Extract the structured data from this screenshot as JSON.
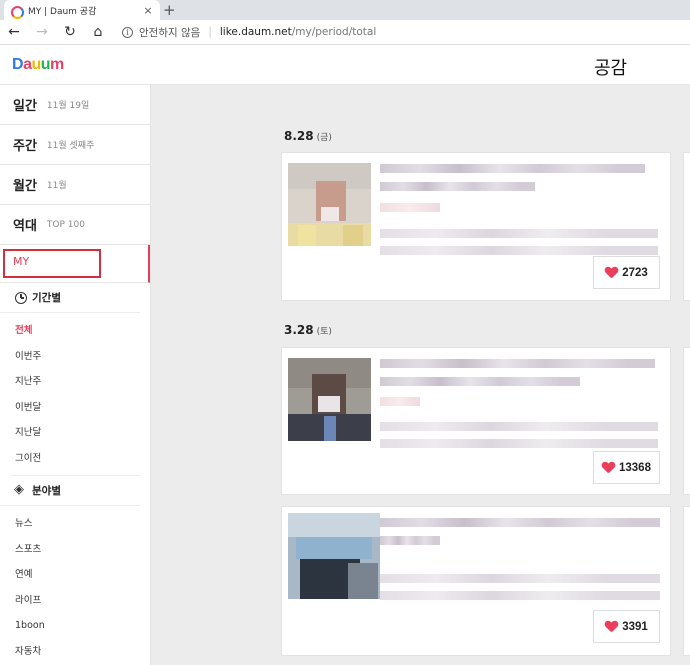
{
  "browser": {
    "tab_title": "MY | Daum 공감",
    "tab_close": "×",
    "new_tab": "+",
    "back": "←",
    "forward": "→",
    "reload": "↻",
    "home": "⌂",
    "security_label": "안전하지 않음",
    "url_host": "like.daum.net",
    "url_path": "/my/period/total"
  },
  "header": {
    "logo": [
      "D",
      "a",
      "u",
      "u",
      "m"
    ],
    "title": "공감"
  },
  "sidebar": {
    "periods": [
      {
        "name": "일간",
        "date": "11월 19일"
      },
      {
        "name": "주간",
        "date": "11월 셋째주"
      },
      {
        "name": "월간",
        "date": "11월"
      },
      {
        "name": "역대",
        "date": "TOP 100"
      }
    ],
    "my_label": "MY",
    "by_period": {
      "title": "기간별",
      "items": [
        "전체",
        "이번주",
        "지난주",
        "이번달",
        "지난달",
        "그이전"
      ],
      "active_index": 0
    },
    "by_category": {
      "title": "분야별",
      "items": [
        "뉴스",
        "스포츠",
        "연예",
        "라이프",
        "1boon",
        "자동차"
      ]
    }
  },
  "main": {
    "groups": [
      {
        "date": "8.28",
        "dow": "(금)",
        "likes": "2723"
      },
      {
        "date": "3.28",
        "dow": "(토)",
        "likes": "13368"
      }
    ],
    "extra_card": {
      "likes": "3391"
    }
  },
  "colors": {
    "accent": "#e53e5a",
    "highlight_box": "#d32f3f",
    "background": "#ececec"
  }
}
